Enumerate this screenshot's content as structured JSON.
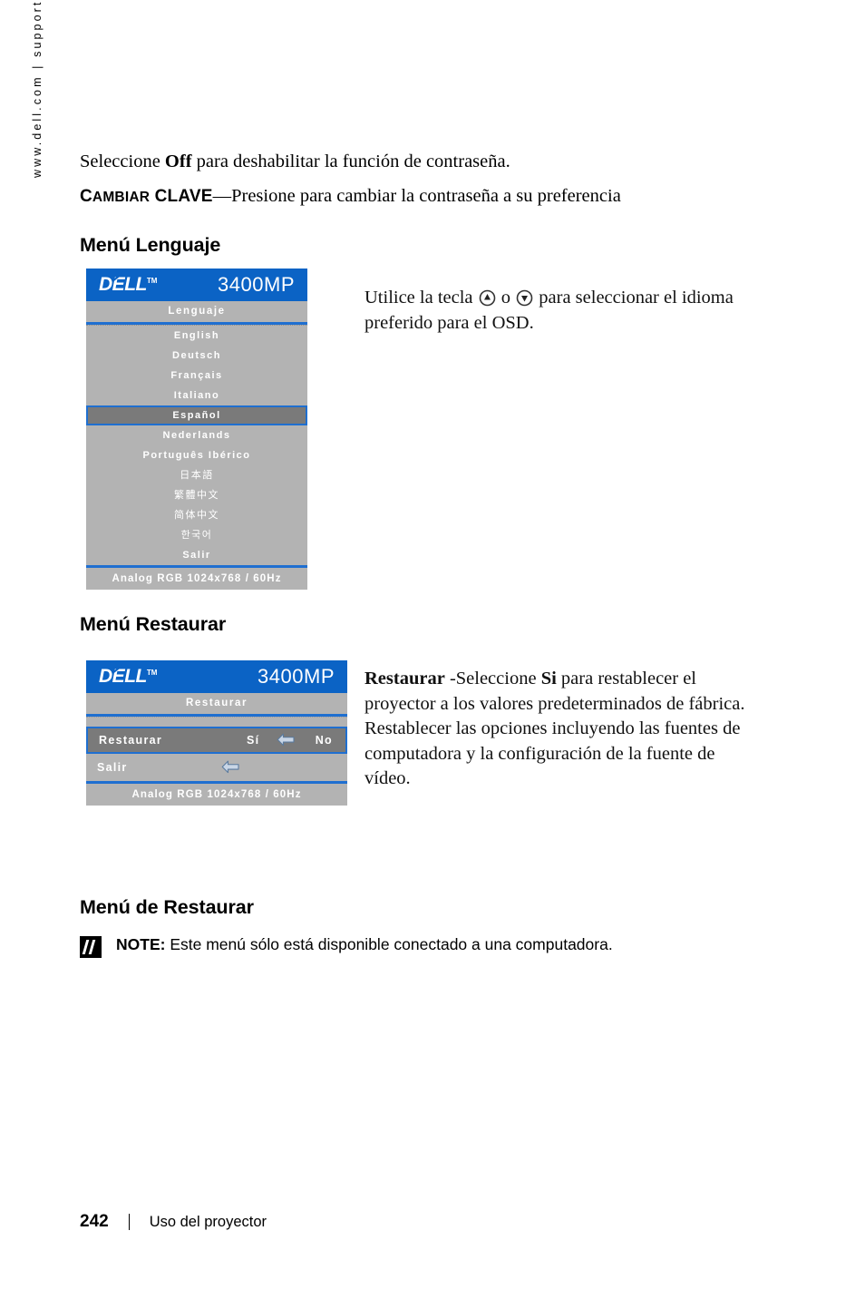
{
  "sidebar": {
    "url_text": "www.dell.com | support.dell.com"
  },
  "intro": {
    "line1_pre": "Seleccione ",
    "line1_bold": "Off",
    "line1_post": " para deshabilitar la función de contraseña.",
    "line2_smallcaps": "C",
    "line2_smallcaps_rest": "AMBIAR",
    "line2_caps": " CLAVE",
    "line2_post": "—Presione para cambiar la contraseña a su preferencia"
  },
  "sections": {
    "lenguaje_heading": "Menú Lenguaje",
    "restaurar_heading": "Menú Restaurar",
    "de_restaurar_heading": "Menú de Restaurar"
  },
  "osd_language": {
    "brand": "DELL",
    "brand_tm": "TM",
    "model": "3400MP",
    "title": "Lenguaje",
    "items": [
      {
        "label": "English",
        "selected": false,
        "cjk": false
      },
      {
        "label": "Deutsch",
        "selected": false,
        "cjk": false
      },
      {
        "label": "Français",
        "selected": false,
        "cjk": false
      },
      {
        "label": "Italiano",
        "selected": false,
        "cjk": false
      },
      {
        "label": "Español",
        "selected": true,
        "cjk": false
      },
      {
        "label": "Nederlands",
        "selected": false,
        "cjk": false
      },
      {
        "label": "Português Ibérico",
        "selected": false,
        "cjk": false
      },
      {
        "label": "日本語",
        "selected": false,
        "cjk": true
      },
      {
        "label": "繁體中文",
        "selected": false,
        "cjk": true
      },
      {
        "label": "简体中文",
        "selected": false,
        "cjk": true
      },
      {
        "label": "한국어",
        "selected": false,
        "cjk": true
      },
      {
        "label": "Salir",
        "selected": false,
        "cjk": false
      }
    ],
    "status": "Analog RGB 1024x768 / 60Hz"
  },
  "osd_restore": {
    "brand": "DELL",
    "brand_tm": "TM",
    "model": "3400MP",
    "title": "Restaurar",
    "row_restaurar_label": "Restaurar",
    "row_restaurar_yes": "Sí",
    "row_restaurar_no": "No",
    "row_salir_label": "Salir",
    "status": "Analog RGB 1024x768 / 60Hz"
  },
  "text_language": {
    "part1": "Utilice la tecla ",
    "part2": " o ",
    "part3": " para seleccionar el idioma preferido para el OSD."
  },
  "text_restore": {
    "bold_lead": "Restaurar",
    "part1": " -Seleccione ",
    "bold_si": "Si",
    "part2": " para restablecer el proyector a los valores predeterminados de fábrica. Restablecer las opciones incluyendo las fuentes de computadora y la configuración de la fuente de vídeo."
  },
  "note": {
    "label": "NOTE:",
    "text": " Este menú sólo está disponible conectado a una computadora."
  },
  "footer": {
    "page_number": "242",
    "title": "Uso del proyector"
  },
  "colors": {
    "dell_blue": "#0b63c5",
    "osd_gray": "#b3b3b3",
    "osd_highlight": "#7a7a7a",
    "osd_border_blue": "#1f6fd0"
  }
}
